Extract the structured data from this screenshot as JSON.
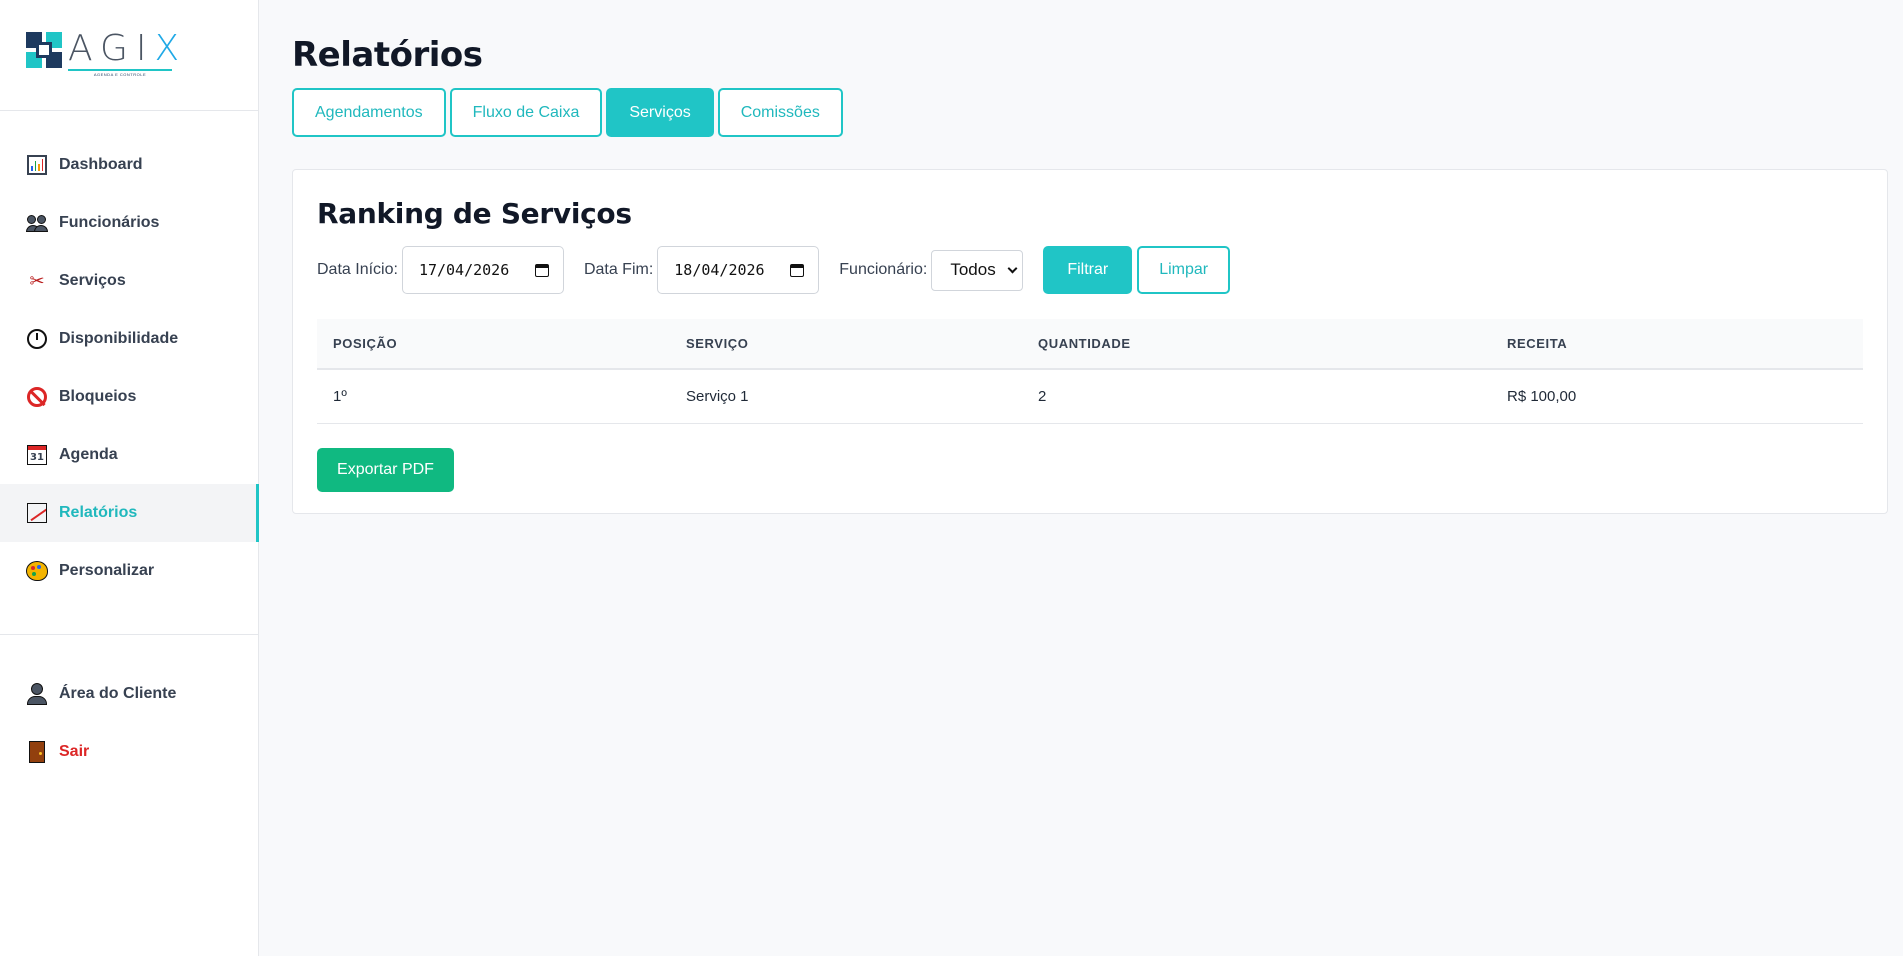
{
  "brand": {
    "name_main": "AGI",
    "name_accent": "X",
    "tagline": "AGENDA E CONTROLE"
  },
  "sidebar": {
    "items": [
      {
        "label": "Dashboard",
        "icon": "bar-chart-icon"
      },
      {
        "label": "Funcionários",
        "icon": "people-icon"
      },
      {
        "label": "Serviços",
        "icon": "scissors-icon"
      },
      {
        "label": "Disponibilidade",
        "icon": "clock-icon"
      },
      {
        "label": "Bloqueios",
        "icon": "prohibited-icon"
      },
      {
        "label": "Agenda",
        "icon": "calendar-icon",
        "icon_text": "31"
      },
      {
        "label": "Relatórios",
        "icon": "line-chart-icon",
        "active": true
      },
      {
        "label": "Personalizar",
        "icon": "palette-icon"
      }
    ],
    "bottom": [
      {
        "label": "Área do Cliente",
        "icon": "user-icon"
      },
      {
        "label": "Sair",
        "icon": "door-icon"
      }
    ]
  },
  "main": {
    "title": "Relatórios",
    "tabs": [
      {
        "label": "Agendamentos"
      },
      {
        "label": "Fluxo de Caixa"
      },
      {
        "label": "Serviços",
        "active": true
      },
      {
        "label": "Comissões"
      }
    ],
    "card": {
      "title": "Ranking de Serviços",
      "filters": {
        "start_label": "Data Início:",
        "start_value": "17/04/2026",
        "end_label": "Data Fim:",
        "end_value": "18/04/2026",
        "employee_label": "Funcionário:",
        "employee_value": "Todos",
        "filter_button": "Filtrar",
        "clear_button": "Limpar"
      },
      "table": {
        "headers": [
          "POSIÇÃO",
          "SERVIÇO",
          "QUANTIDADE",
          "RECEITA"
        ],
        "rows": [
          [
            "1º",
            "Serviço 1",
            "2",
            "R$ 100,00"
          ]
        ]
      },
      "export_button": "Exportar PDF"
    }
  },
  "colors": {
    "accent": "#20c5c6",
    "export": "#10b981",
    "logout": "#dc2626"
  }
}
